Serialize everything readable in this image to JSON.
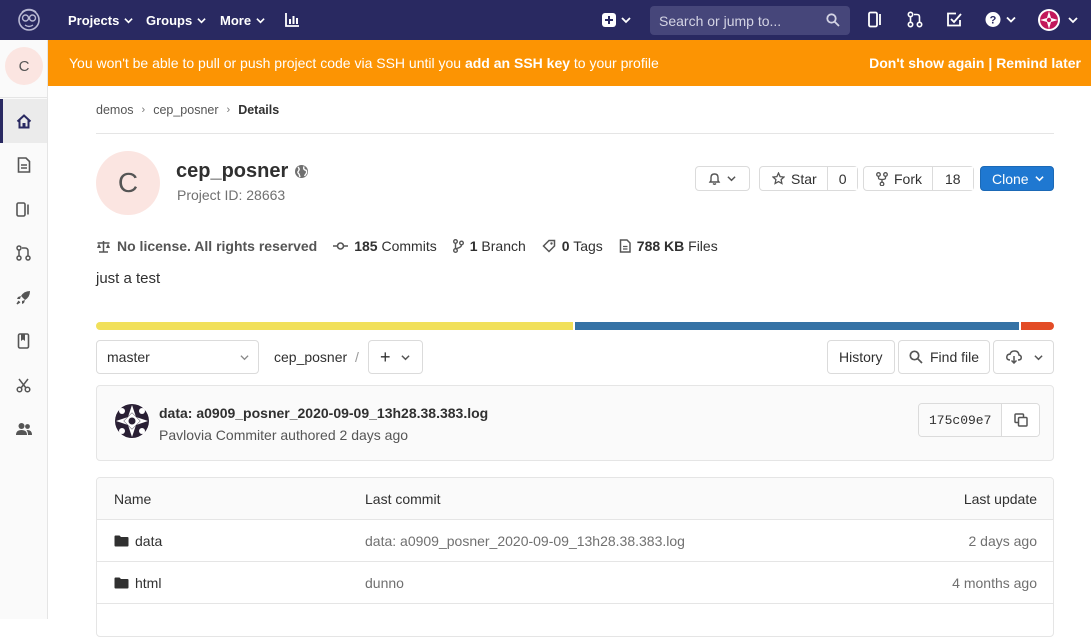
{
  "topnav": {
    "projects": "Projects",
    "groups": "Groups",
    "more": "More",
    "search_placeholder": "Search or jump to..."
  },
  "banner": {
    "msg_before": "You won't be able to pull or push project code via SSH until you ",
    "msg_link": "add an SSH key",
    "msg_after": " to your profile",
    "dont_show": "Don't show again",
    "divider": "|",
    "remind": "Remind later"
  },
  "sidebar": {
    "avatar_letter": "C"
  },
  "breadcrumb": {
    "items": [
      "demos",
      "cep_posner"
    ],
    "current": "Details"
  },
  "project": {
    "avatar_letter": "C",
    "name": "cep_posner",
    "id_label": "Project ID: 28663",
    "description": "just a test"
  },
  "actions": {
    "star": "Star",
    "star_count": "0",
    "fork": "Fork",
    "fork_count": "18",
    "clone": "Clone"
  },
  "stats": {
    "license": "No license. All rights reserved",
    "commits_num": "185",
    "commits_label": "Commits",
    "branch_num": "1",
    "branch_label": "Branch",
    "tags_num": "0",
    "tags_label": "Tags",
    "files_num": "788 KB",
    "files_label": "Files"
  },
  "languages": [
    {
      "color": "#f1e05a",
      "percent": 50
    },
    {
      "color": "#3572a5",
      "percent": 46.5
    },
    {
      "color": "#e34c26",
      "percent": 3.5
    }
  ],
  "toolbar": {
    "branch": "master",
    "path": "cep_posner",
    "path_sep": "/",
    "add": "+",
    "history": "History",
    "find_file": "Find file"
  },
  "last_commit": {
    "title": "data: a0909_posner_2020-09-09_13h28.38.383.log",
    "meta": "Pavlovia Commiter authored 2 days ago",
    "sha": "175c09e7"
  },
  "files": {
    "headers": {
      "name": "Name",
      "last_commit": "Last commit",
      "last_update": "Last update"
    },
    "rows": [
      {
        "name": "data",
        "commit": "data: a0909_posner_2020-09-09_13h28.38.383.log",
        "updated": "2 days ago"
      },
      {
        "name": "html",
        "commit": "dunno",
        "updated": "4 months ago"
      }
    ]
  },
  "colors": {
    "nav_bg": "#292961",
    "banner_bg": "#fc9403",
    "primary": "#1f78d1"
  }
}
